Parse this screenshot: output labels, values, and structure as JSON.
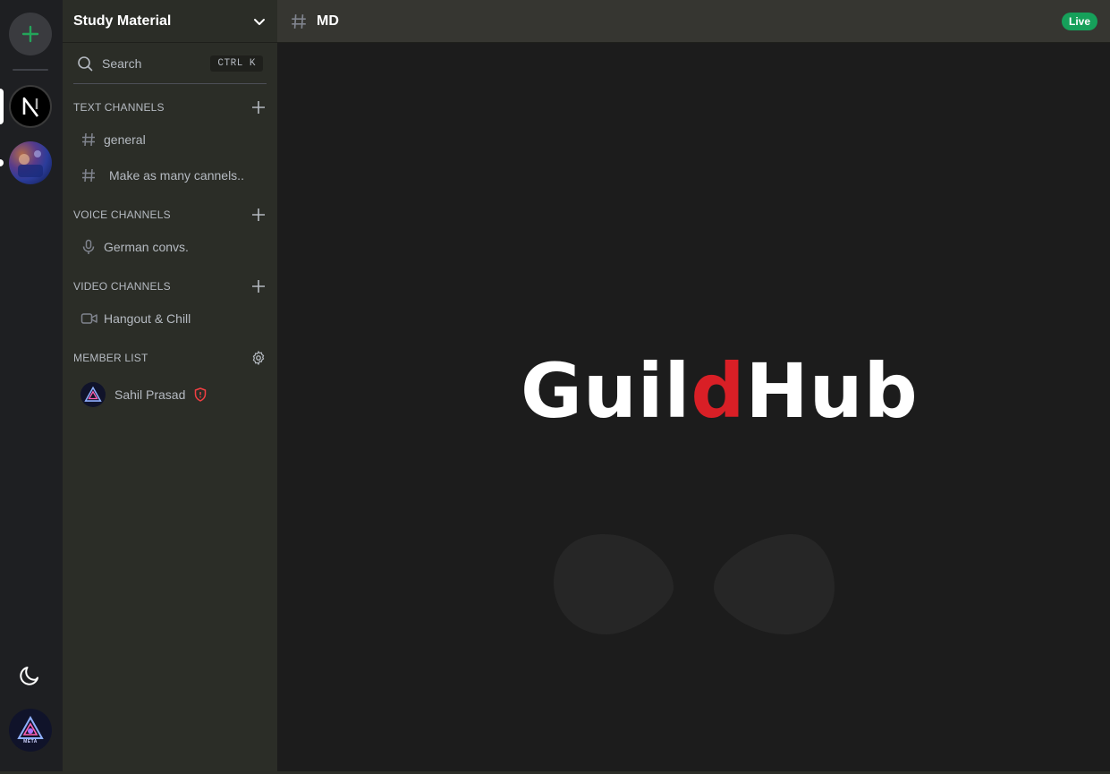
{
  "rail": {
    "add_icon": "plus-icon",
    "servers": [
      {
        "name": "next-server",
        "icon": "nextjs-logo"
      },
      {
        "name": "photo-server",
        "icon": "photo-avatar"
      }
    ],
    "theme_icon": "moon-icon",
    "user_avatar_text": "META"
  },
  "sidebar": {
    "server_name": "Study Material",
    "search": {
      "label": "Search",
      "shortcut": "CTRL  K"
    },
    "sections": {
      "text": "TEXT CHANNELS",
      "voice": "VOICE CHANNELS",
      "video": "VIDEO CHANNELS",
      "members": "MEMBER LIST"
    },
    "text_channels": [
      "general",
      "Make as many cannels.."
    ],
    "voice_channels": [
      "German convs."
    ],
    "video_channels": [
      "Hangout & Chill"
    ],
    "members": [
      {
        "name": "Sahil Prasad",
        "role_icon": "shield-alert-icon"
      }
    ]
  },
  "topbar": {
    "channel": "MD",
    "status": "Live"
  },
  "main": {
    "logo_part1": "Guil",
    "logo_part2": "d",
    "logo_part3": "Hub"
  },
  "colors": {
    "accent_green": "#16a05a",
    "logo_red": "#d91f26",
    "sidebar_bg": "#2b2d27",
    "main_bg": "#1c1c1c"
  }
}
